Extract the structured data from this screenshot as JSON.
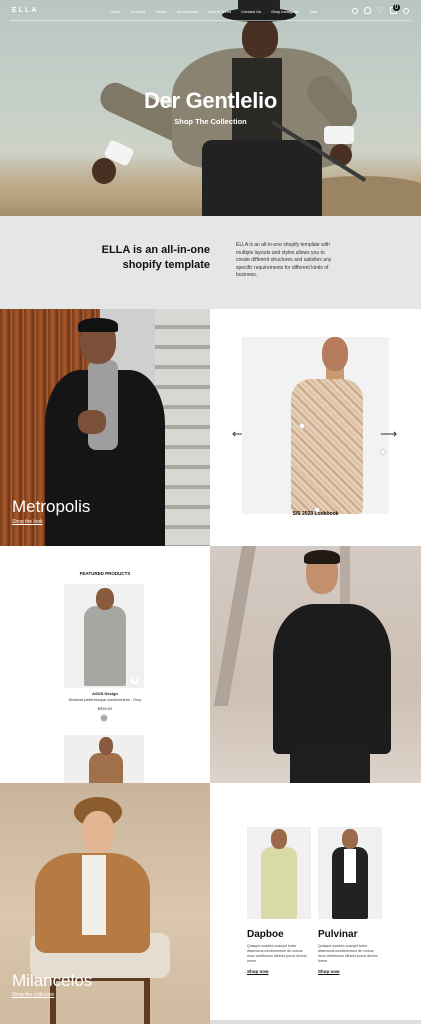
{
  "header": {
    "logo": "ELLA",
    "menu": [
      "Home",
      "Clothing",
      "Shoes",
      "Accessories",
      "Sports Trend",
      "Contact Us",
      "Shop Instagram",
      "Sale"
    ],
    "cart_count": "0",
    "icons": [
      "search-icon",
      "user-icon",
      "heart-icon",
      "bag-icon",
      "globe-icon"
    ]
  },
  "hero": {
    "title": "Der Gentlelio",
    "link": "Shop The Collection"
  },
  "intro": {
    "heading": "ELLA is an all-in-one shopify template",
    "text": "ELLA is an all-in-one shopify template with multiple layouts and styles allows you to create different structures and satisfies any specific requirements for different kinds of business."
  },
  "metropolis": {
    "title": "Metropolis",
    "link": "Shop the look"
  },
  "lookbook": {
    "caption": "S/S 2023 Lookbook",
    "prev": "⟵",
    "next": "⟶"
  },
  "featured": {
    "title": "FEATURED PRODUCTS",
    "product": {
      "brand": "ASOS Design",
      "name": "Dictumst pellentesque condimentum - Grey",
      "price": "$999.00",
      "heart": "♡"
    }
  },
  "milancelos": {
    "title": "Milancelos",
    "link": "Shop the collection"
  },
  "duo": [
    {
      "name": "Dapboe",
      "desc": "Quisque sodales suscipit tortor ditaemcus condimentum de cursus risus vestibulum ultrices purus dictum lorem.",
      "link": "Shop now"
    },
    {
      "name": "Pulvinar",
      "desc": "Quisque sodales suscipit tortor ditaemcus condimentum de cursus risus vestibulum ultrices purus dictum lorem.",
      "link": "Shop now"
    }
  ],
  "colors": {
    "intro_bg": "#e6e6e6",
    "text": "#111111"
  }
}
